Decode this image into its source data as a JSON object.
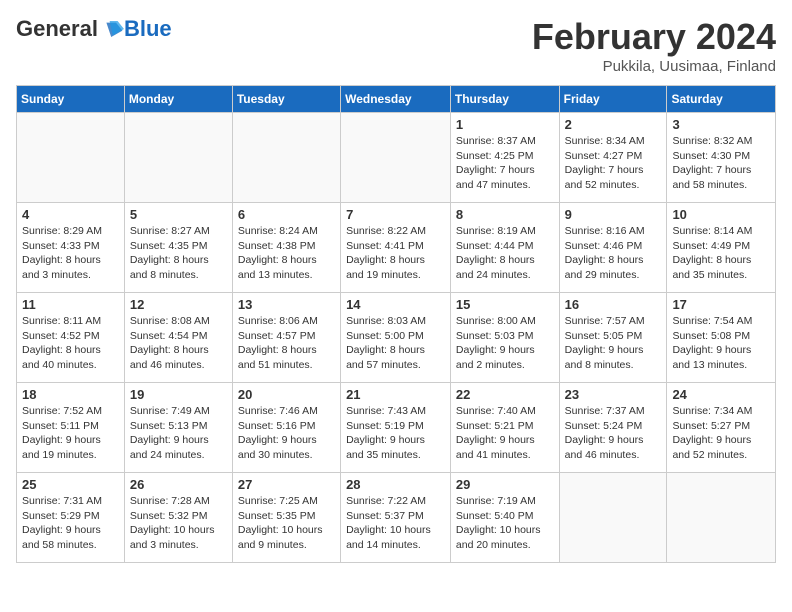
{
  "header": {
    "logo_general": "General",
    "logo_blue": "Blue",
    "month_year": "February 2024",
    "location": "Pukkila, Uusimaa, Finland"
  },
  "weekdays": [
    "Sunday",
    "Monday",
    "Tuesday",
    "Wednesday",
    "Thursday",
    "Friday",
    "Saturday"
  ],
  "weeks": [
    [
      {
        "day": "",
        "info": ""
      },
      {
        "day": "",
        "info": ""
      },
      {
        "day": "",
        "info": ""
      },
      {
        "day": "",
        "info": ""
      },
      {
        "day": "1",
        "info": "Sunrise: 8:37 AM\nSunset: 4:25 PM\nDaylight: 7 hours\nand 47 minutes."
      },
      {
        "day": "2",
        "info": "Sunrise: 8:34 AM\nSunset: 4:27 PM\nDaylight: 7 hours\nand 52 minutes."
      },
      {
        "day": "3",
        "info": "Sunrise: 8:32 AM\nSunset: 4:30 PM\nDaylight: 7 hours\nand 58 minutes."
      }
    ],
    [
      {
        "day": "4",
        "info": "Sunrise: 8:29 AM\nSunset: 4:33 PM\nDaylight: 8 hours\nand 3 minutes."
      },
      {
        "day": "5",
        "info": "Sunrise: 8:27 AM\nSunset: 4:35 PM\nDaylight: 8 hours\nand 8 minutes."
      },
      {
        "day": "6",
        "info": "Sunrise: 8:24 AM\nSunset: 4:38 PM\nDaylight: 8 hours\nand 13 minutes."
      },
      {
        "day": "7",
        "info": "Sunrise: 8:22 AM\nSunset: 4:41 PM\nDaylight: 8 hours\nand 19 minutes."
      },
      {
        "day": "8",
        "info": "Sunrise: 8:19 AM\nSunset: 4:44 PM\nDaylight: 8 hours\nand 24 minutes."
      },
      {
        "day": "9",
        "info": "Sunrise: 8:16 AM\nSunset: 4:46 PM\nDaylight: 8 hours\nand 29 minutes."
      },
      {
        "day": "10",
        "info": "Sunrise: 8:14 AM\nSunset: 4:49 PM\nDaylight: 8 hours\nand 35 minutes."
      }
    ],
    [
      {
        "day": "11",
        "info": "Sunrise: 8:11 AM\nSunset: 4:52 PM\nDaylight: 8 hours\nand 40 minutes."
      },
      {
        "day": "12",
        "info": "Sunrise: 8:08 AM\nSunset: 4:54 PM\nDaylight: 8 hours\nand 46 minutes."
      },
      {
        "day": "13",
        "info": "Sunrise: 8:06 AM\nSunset: 4:57 PM\nDaylight: 8 hours\nand 51 minutes."
      },
      {
        "day": "14",
        "info": "Sunrise: 8:03 AM\nSunset: 5:00 PM\nDaylight: 8 hours\nand 57 minutes."
      },
      {
        "day": "15",
        "info": "Sunrise: 8:00 AM\nSunset: 5:03 PM\nDaylight: 9 hours\nand 2 minutes."
      },
      {
        "day": "16",
        "info": "Sunrise: 7:57 AM\nSunset: 5:05 PM\nDaylight: 9 hours\nand 8 minutes."
      },
      {
        "day": "17",
        "info": "Sunrise: 7:54 AM\nSunset: 5:08 PM\nDaylight: 9 hours\nand 13 minutes."
      }
    ],
    [
      {
        "day": "18",
        "info": "Sunrise: 7:52 AM\nSunset: 5:11 PM\nDaylight: 9 hours\nand 19 minutes."
      },
      {
        "day": "19",
        "info": "Sunrise: 7:49 AM\nSunset: 5:13 PM\nDaylight: 9 hours\nand 24 minutes."
      },
      {
        "day": "20",
        "info": "Sunrise: 7:46 AM\nSunset: 5:16 PM\nDaylight: 9 hours\nand 30 minutes."
      },
      {
        "day": "21",
        "info": "Sunrise: 7:43 AM\nSunset: 5:19 PM\nDaylight: 9 hours\nand 35 minutes."
      },
      {
        "day": "22",
        "info": "Sunrise: 7:40 AM\nSunset: 5:21 PM\nDaylight: 9 hours\nand 41 minutes."
      },
      {
        "day": "23",
        "info": "Sunrise: 7:37 AM\nSunset: 5:24 PM\nDaylight: 9 hours\nand 46 minutes."
      },
      {
        "day": "24",
        "info": "Sunrise: 7:34 AM\nSunset: 5:27 PM\nDaylight: 9 hours\nand 52 minutes."
      }
    ],
    [
      {
        "day": "25",
        "info": "Sunrise: 7:31 AM\nSunset: 5:29 PM\nDaylight: 9 hours\nand 58 minutes."
      },
      {
        "day": "26",
        "info": "Sunrise: 7:28 AM\nSunset: 5:32 PM\nDaylight: 10 hours\nand 3 minutes."
      },
      {
        "day": "27",
        "info": "Sunrise: 7:25 AM\nSunset: 5:35 PM\nDaylight: 10 hours\nand 9 minutes."
      },
      {
        "day": "28",
        "info": "Sunrise: 7:22 AM\nSunset: 5:37 PM\nDaylight: 10 hours\nand 14 minutes."
      },
      {
        "day": "29",
        "info": "Sunrise: 7:19 AM\nSunset: 5:40 PM\nDaylight: 10 hours\nand 20 minutes."
      },
      {
        "day": "",
        "info": ""
      },
      {
        "day": "",
        "info": ""
      }
    ]
  ]
}
